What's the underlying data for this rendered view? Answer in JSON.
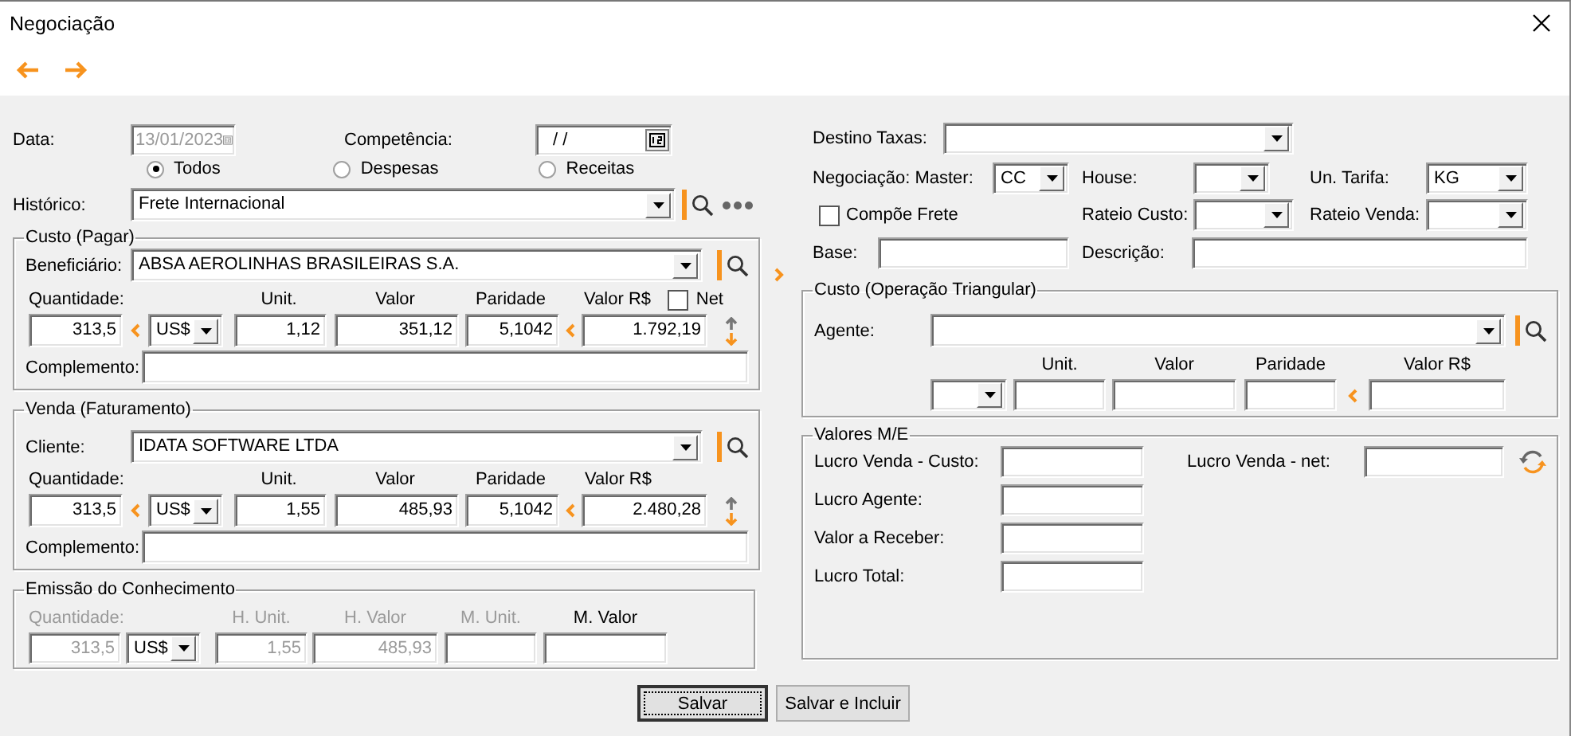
{
  "window": {
    "title": "Negociação"
  },
  "left": {
    "date": {
      "label": "Data:",
      "value": "13/01/2023",
      "disabled": true
    },
    "competencia": {
      "label": "Competência:",
      "value": "/ /",
      "disabled": false
    },
    "filter": [
      {
        "label": "Todos",
        "selected": true
      },
      {
        "label": "Despesas",
        "selected": false
      },
      {
        "label": "Receitas",
        "selected": false
      }
    ],
    "historico": {
      "label": "Histórico:",
      "value": "Frete Internacional"
    },
    "groups": [
      {
        "title": "Custo (Pagar)",
        "party_label": "Beneficiário:",
        "party": "ABSA AEROLINHAS BRASILEIRAS S.A.",
        "columns": [
          "Quantidade:",
          "Unit.",
          "Valor",
          "Paridade",
          "Valor R$"
        ],
        "net": {
          "label": "Net",
          "checked": false
        },
        "quantity": "313,5",
        "currency": "US$",
        "unit": "1,12",
        "value": "351,12",
        "parity": "5,1042",
        "value_brl": "1.792,19",
        "complement_label": "Complemento:"
      },
      {
        "title": "Venda (Faturamento)",
        "party_label": "Cliente:",
        "party": "IDATA SOFTWARE LTDA",
        "columns": [
          "Quantidade:",
          "Unit.",
          "Valor",
          "Paridade",
          "Valor R$"
        ],
        "quantity": "313,5",
        "currency": "US$",
        "unit": "1,55",
        "value": "485,93",
        "parity": "5,1042",
        "value_brl": "2.480,28",
        "complement_label": "Complemento:"
      }
    ],
    "emissao": {
      "title": "Emissão do Conhecimento",
      "columns": [
        {
          "kind": "field",
          "label": "Quantidade:",
          "value": "313,5",
          "disabled": true
        },
        {
          "kind": "combo",
          "value": "US$",
          "disabled": false
        },
        {
          "kind": "field",
          "label": "H. Unit.",
          "value": "1,55",
          "disabled": true
        },
        {
          "kind": "field",
          "label": "H. Valor",
          "value": "485,93",
          "disabled": true
        },
        {
          "kind": "field",
          "label": "M. Unit.",
          "disabled": true
        },
        {
          "kind": "field",
          "label": "M. Valor",
          "disabled": false
        }
      ]
    }
  },
  "right": {
    "destino_taxas": {
      "label": "Destino Taxas:"
    },
    "master": {
      "label": "Negociação: Master:",
      "value": "CC"
    },
    "house": {
      "label": "House:"
    },
    "un_tarifa": {
      "label": "Un. Tarifa:",
      "value": "KG"
    },
    "compoe_frete": {
      "label": "Compõe Frete",
      "checked": false
    },
    "rateio_custo": {
      "label": "Rateio Custo:"
    },
    "rateio_venda": {
      "label": "Rateio Venda:"
    },
    "base": {
      "label": "Base:"
    },
    "descricao": {
      "label": "Descrição:"
    },
    "triangular": {
      "title": "Custo (Operação Triangular)",
      "agent_label": "Agente:",
      "columns": [
        "Unit.",
        "Valor",
        "Paridade",
        "Valor R$"
      ]
    },
    "valores": {
      "title": "Valores M/E",
      "left_fields": [
        "Lucro Venda - Custo:",
        "Lucro Agente:",
        "Valor a Receber:",
        "Lucro Total:"
      ],
      "net_label": "Lucro Venda - net:"
    }
  },
  "buttons": [
    {
      "label": "Salvar",
      "default": true
    },
    {
      "label": "Salvar e Incluir",
      "default": false
    }
  ]
}
